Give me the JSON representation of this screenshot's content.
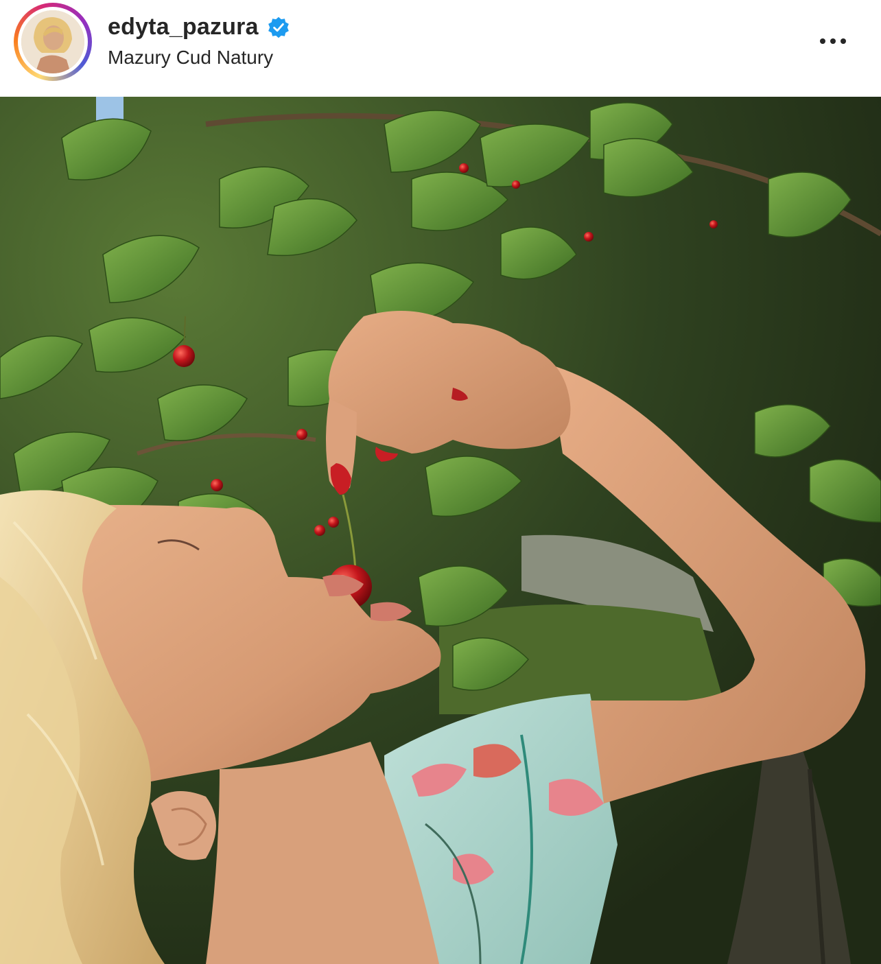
{
  "post": {
    "username": "edyta_pazura",
    "verified": true,
    "location": "Mazury Cud Natury",
    "verified_icon": "verified-badge-icon",
    "more_icon": "more-horizontal-icon",
    "colors": {
      "verified_blue": "#1d9bf0",
      "text": "#262626",
      "ring_gradient": [
        "#feda75",
        "#fa7e1e",
        "#d62976",
        "#962fbf",
        "#4f5bd5"
      ]
    }
  }
}
